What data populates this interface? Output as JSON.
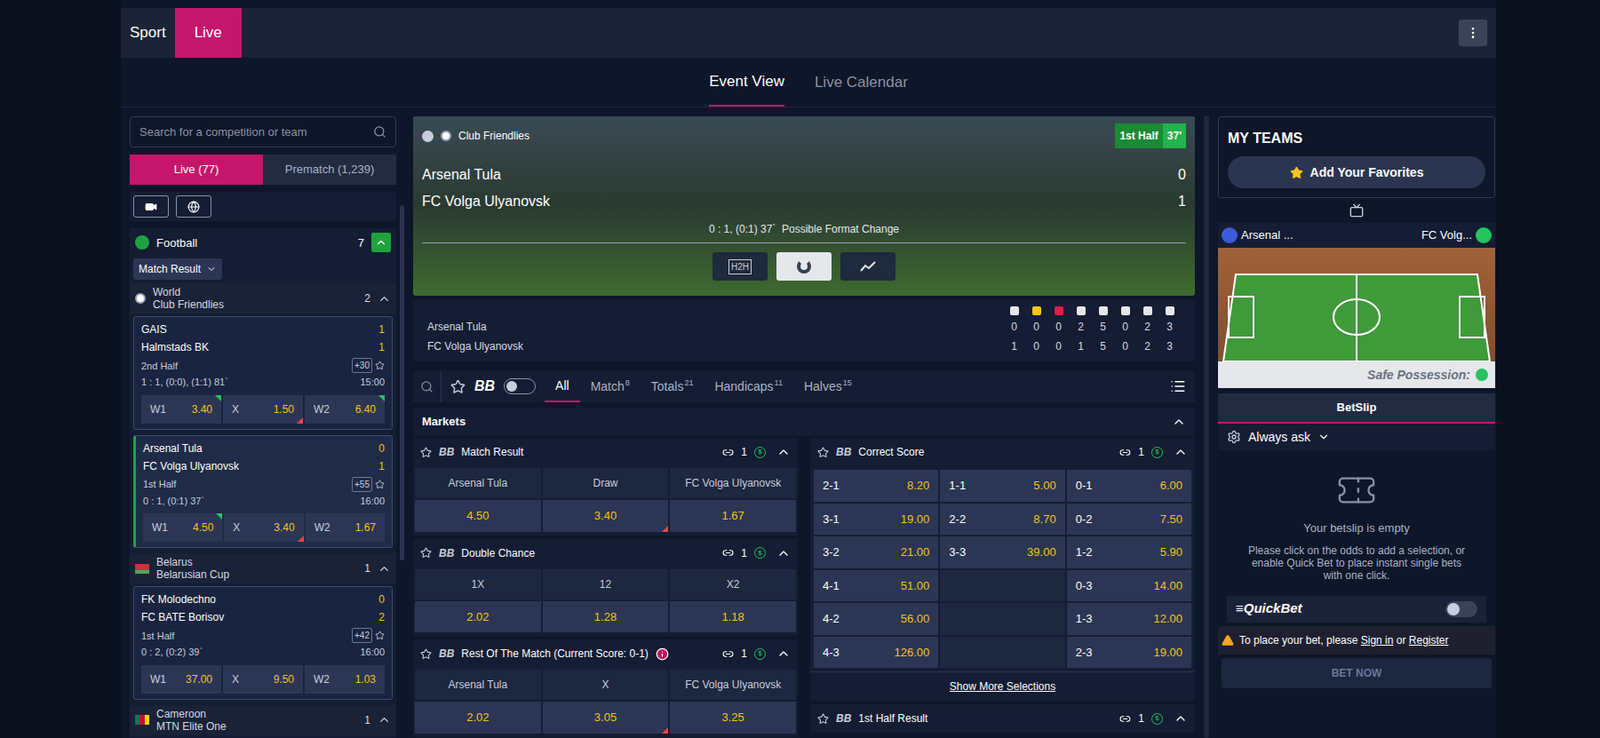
{
  "topbar": {
    "tabs": [
      {
        "label": "Sport",
        "selected": false
      },
      {
        "label": "Live",
        "selected": true
      }
    ]
  },
  "view_tabs": [
    {
      "label": "Event View",
      "selected": true
    },
    {
      "label": "Live Calendar",
      "selected": false
    }
  ],
  "sidebar": {
    "search": {
      "placeholder": "Search for a competition or team"
    },
    "mode_tabs": [
      {
        "label": "Live (77)",
        "selected": true
      },
      {
        "label": "Prematch (1,239)",
        "selected": false
      }
    ],
    "filters": [
      {
        "kind": "video",
        "selected": false
      },
      {
        "kind": "globe",
        "selected": false
      }
    ],
    "sport": {
      "name": "Football",
      "count": "7",
      "expanded": true
    },
    "market_select": "Match Result",
    "competitions": [
      {
        "country": "World",
        "name": "Club Friendlies",
        "count": "2",
        "expanded": true,
        "flag": "world",
        "matches": [
          {
            "home": "GAIS",
            "away": "Halmstads BK",
            "home_score": "1",
            "away_score": "1",
            "period": "2nd Half",
            "more": "+30",
            "info": "1 : 1, (0:0), (1:1) 81`",
            "time": "15:00",
            "selected": false,
            "odds": [
              {
                "label": "W1",
                "value": "3.40",
                "trend": "up"
              },
              {
                "label": "X",
                "value": "1.50",
                "trend": "down"
              },
              {
                "label": "W2",
                "value": "6.40",
                "trend": "up"
              }
            ]
          },
          {
            "home": "Arsenal Tula",
            "away": "FC Volga Ulyanovsk",
            "home_score": "0",
            "away_score": "1",
            "period": "1st Half",
            "more": "+55",
            "info": "0 : 1, (0:1) 37`",
            "time": "16:00",
            "selected": true,
            "odds": [
              {
                "label": "W1",
                "value": "4.50",
                "trend": "up"
              },
              {
                "label": "X",
                "value": "3.40",
                "trend": "down"
              },
              {
                "label": "W2",
                "value": "1.67",
                "trend": "none"
              }
            ]
          }
        ]
      },
      {
        "country": "Belarus",
        "name": "Belarusian Cup",
        "count": "1",
        "expanded": true,
        "flag": "belarus",
        "matches": [
          {
            "home": "FK Molodechno",
            "away": "FC BATE Borisov",
            "home_score": "0",
            "away_score": "2",
            "period": "1st Half",
            "more": "+42",
            "info": "0 : 2, (0:2) 39`",
            "time": "16:00",
            "selected": false,
            "odds": [
              {
                "label": "W1",
                "value": "37.00",
                "trend": "none"
              },
              {
                "label": "X",
                "value": "9.50",
                "trend": "none"
              },
              {
                "label": "W2",
                "value": "1.03",
                "trend": "none"
              }
            ]
          }
        ]
      },
      {
        "country": "Cameroon",
        "name": "MTN Elite One",
        "count": "1",
        "expanded": true,
        "flag": "cameroon",
        "matches": []
      }
    ]
  },
  "event": {
    "competition": "Club Friendlies",
    "period": "1st Half",
    "minute": "37'",
    "home": "Arsenal Tula",
    "away": "FC Volga Ulyanovsk",
    "home_score": "0",
    "away_score": "1",
    "info": "0 : 1, (0:1) 37`  Possible Format Change",
    "view_buttons": [
      {
        "label": "H2H",
        "kind": "h2h",
        "selected": false
      },
      {
        "label": "",
        "kind": "pie",
        "selected": true
      },
      {
        "label": "",
        "kind": "chart",
        "selected": false
      }
    ],
    "stats": {
      "columns": [
        "#e5e7eb",
        "#f5c518",
        "#e11d48",
        "#e5e7eb",
        "#e5e7eb",
        "#e5e7eb",
        "#e5e7eb",
        "#e5e7eb"
      ],
      "rows": [
        {
          "team": "Arsenal Tula",
          "values": [
            "0",
            "0",
            "0",
            "2",
            "5",
            "0",
            "2",
            "3"
          ]
        },
        {
          "team": "FC Volga Ulyanovsk",
          "values": [
            "1",
            "0",
            "0",
            "1",
            "5",
            "0",
            "2",
            "3"
          ]
        }
      ]
    }
  },
  "market_tabs": {
    "bet_builder": "BB",
    "toggle_on": false,
    "tabs": [
      {
        "label": "All",
        "count": "",
        "selected": true
      },
      {
        "label": "Match",
        "count": "8",
        "selected": false
      },
      {
        "label": "Totals",
        "count": "21",
        "selected": false
      },
      {
        "label": "Handicaps",
        "count": "11",
        "selected": false
      },
      {
        "label": "Halves",
        "count": "15",
        "selected": false
      }
    ]
  },
  "markets_header": {
    "title": "Markets",
    "expanded": true
  },
  "markets_left": [
    {
      "title": "Match Result",
      "links": "1",
      "info": false,
      "cols": [
        "Arsenal Tula",
        "Draw",
        "FC Volga Ulyanovsk"
      ],
      "odds": [
        {
          "value": "4.50",
          "trend": "none"
        },
        {
          "value": "3.40",
          "trend": "down"
        },
        {
          "value": "1.67",
          "trend": "none"
        }
      ]
    },
    {
      "title": "Double Chance",
      "links": "1",
      "info": false,
      "cols": [
        "1X",
        "12",
        "X2"
      ],
      "odds": [
        {
          "value": "2.02",
          "trend": "none"
        },
        {
          "value": "1.28",
          "trend": "none"
        },
        {
          "value": "1.18",
          "trend": "none"
        }
      ]
    },
    {
      "title": "Rest Of The Match (Current Score: 0-1)",
      "links": "1",
      "info": true,
      "cols": [
        "Arsenal Tula",
        "X",
        "FC Volga Ulyanovsk"
      ],
      "odds": [
        {
          "value": "2.02",
          "trend": "none"
        },
        {
          "value": "3.05",
          "trend": "down"
        },
        {
          "value": "3.25",
          "trend": "none"
        }
      ]
    }
  ],
  "correct_score": {
    "title": "Correct Score",
    "links": "1",
    "rows": [
      [
        {
          "score": "2-1",
          "odds": "8.20"
        },
        {
          "score": "1-1",
          "odds": "5.00"
        },
        {
          "score": "0-1",
          "odds": "6.00"
        }
      ],
      [
        {
          "score": "3-1",
          "odds": "19.00"
        },
        {
          "score": "2-2",
          "odds": "8.70"
        },
        {
          "score": "0-2",
          "odds": "7.50"
        }
      ],
      [
        {
          "score": "3-2",
          "odds": "21.00"
        },
        {
          "score": "3-3",
          "odds": "39.00"
        },
        {
          "score": "1-2",
          "odds": "5.90"
        }
      ],
      [
        {
          "score": "4-1",
          "odds": "51.00"
        },
        null,
        {
          "score": "0-3",
          "odds": "14.00"
        }
      ],
      [
        {
          "score": "4-2",
          "odds": "56.00"
        },
        null,
        {
          "score": "1-3",
          "odds": "12.00"
        }
      ],
      [
        {
          "score": "4-3",
          "odds": "126.00"
        },
        null,
        {
          "score": "2-3",
          "odds": "19.00"
        }
      ]
    ],
    "show_more": "Show More Selections"
  },
  "next_market": {
    "title": "1st Half Result",
    "links": "1"
  },
  "right": {
    "my_teams": {
      "title": "MY TEAMS",
      "button": "Add Your Favorites"
    },
    "widget": {
      "home": "Arsenal ...",
      "away": "FC Volg...",
      "status": "Safe Possession:"
    },
    "betslip": {
      "title": "BetSlip",
      "mode": "Always ask",
      "empty_title": "Your betslip is empty",
      "empty_text": "Please click on the odds to add a selection, or enable Quick Bet to place instant single bets with one click.",
      "quickbet": "QuickBet",
      "quickbet_on": false,
      "notice": {
        "before": "To place your bet, please",
        "sign_in": "Sign in",
        "or": "or",
        "register": "Register"
      },
      "bet_button": "BET NOW",
      "bet_disabled": true
    }
  }
}
